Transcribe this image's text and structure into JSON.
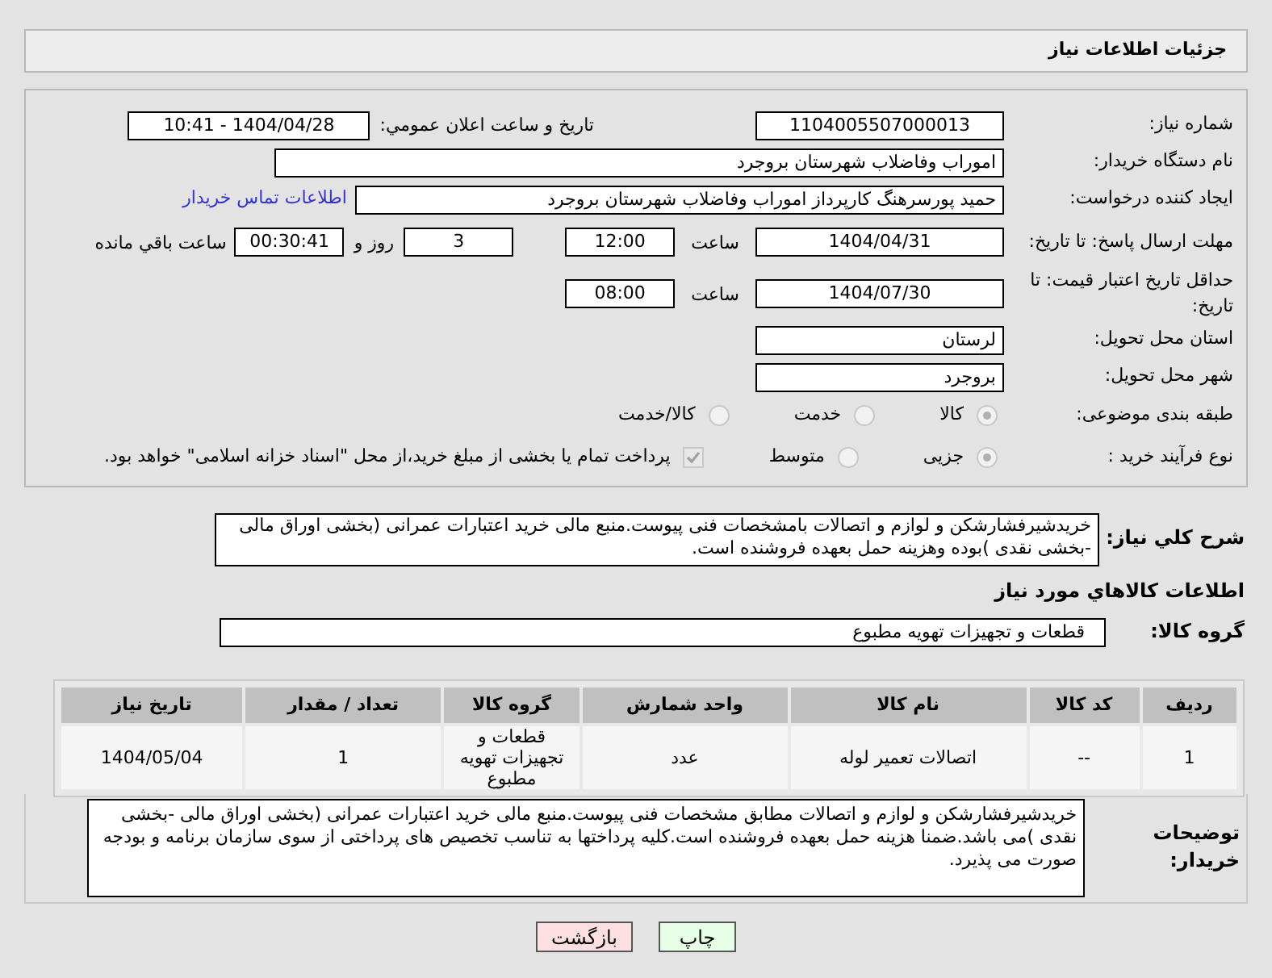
{
  "title": "جزئیات اطلاعات نیاز",
  "need_number": {
    "label": "شماره نیاز:",
    "value": "1104005507000013"
  },
  "announce": {
    "label": "تاریخ و ساعت اعلان عمومي:",
    "value": "1404/04/28 - 10:41"
  },
  "buyer": {
    "label": "نام دستگاه خريدار:",
    "value": "اموراب وفاضلاب شهرستان بروجرد"
  },
  "creator": {
    "label": "ايجاد کننده درخواست:",
    "value": "حمید پورسرهنگ کارپرداز اموراب وفاضلاب شهرستان بروجرد",
    "link": "اطلاعات تماس خريدار"
  },
  "deadline": {
    "label": "مهلت ارسال پاسخ: تا تاريخ:",
    "date": "1404/04/31",
    "time_label": "ساعت",
    "time": "12:00",
    "days": "3",
    "days_label": "روز و",
    "remaining": "00:30:41",
    "remaining_label": "ساعت باقي مانده"
  },
  "validity": {
    "label": "حداقل تاريخ اعتبار قيمت: تا تاريخ:",
    "date": "1404/07/30",
    "time_label": "ساعت",
    "time": "08:00"
  },
  "province": {
    "label": "استان محل تحويل:",
    "value": "لرستان"
  },
  "city": {
    "label": "شهر محل تحويل:",
    "value": "بروجرد"
  },
  "category": {
    "label": "طبقه بندی موضوعی:",
    "options": [
      {
        "label": "کالا",
        "selected": true
      },
      {
        "label": "خدمت",
        "selected": false
      },
      {
        "label": "کالا/خدمت",
        "selected": false
      }
    ]
  },
  "process": {
    "label": "نوع فرآیند خرید :",
    "options": [
      {
        "label": "جزیی",
        "selected": true
      },
      {
        "label": "متوسط",
        "selected": false
      }
    ],
    "treasury": {
      "label": "پرداخت تمام يا بخشی از مبلغ خريد،از محل \"اسناد خزانه اسلامی\" خواهد بود.",
      "checked": true
    }
  },
  "description": {
    "label": "شرح کلي نياز:",
    "value": "خریدشیرفشارشکن و لوازم و اتصالات بامشخصات فنی پیوست.منبع مالی خرید اعتبارات عمرانی (بخشی اوراق مالی -بخشی نقدی )بوده وهزینه حمل بعهده فروشنده است."
  },
  "goods_heading": "اطلاعات کالاهاي مورد نياز",
  "goods_group": {
    "label": "گروه کالا:",
    "value": "قطعات و تجهیزات تهویه مطبوع"
  },
  "table": {
    "columns": [
      "رديف",
      "کد کالا",
      "نام کالا",
      "واحد شمارش",
      "گروه کالا",
      "تعداد / مقدار",
      "تاريخ نياز"
    ],
    "rows": [
      [
        "1",
        "--",
        "اتصالات تعمیر لوله",
        "عدد",
        "قطعات و تجهیزات تهویه مطبوع",
        "1",
        "1404/05/04"
      ]
    ]
  },
  "buyer_notes": {
    "label": "توضيحات خريدار:",
    "value": "خریدشیرفشارشکن و لوازم و اتصالات مطابق مشخصات فنی پیوست.منبع مالی خرید اعتبارات عمرانی (بخشی اوراق مالی -بخشی نقدی )می باشد.ضمنا هزینه حمل بعهده فروشنده است.کلیه پرداختها به تناسب تخصیص های پرداختی از سوی سازمان برنامه و بودجه صورت می پذیرد."
  },
  "buttons": [
    {
      "kind": "print",
      "label": "چاپ"
    },
    {
      "kind": "back",
      "label": "بازگشت"
    }
  ]
}
